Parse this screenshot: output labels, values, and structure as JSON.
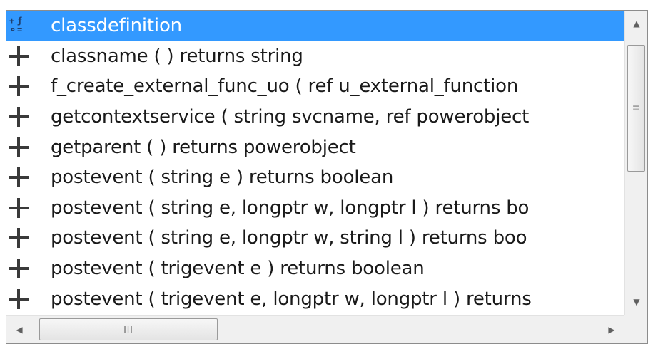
{
  "list": {
    "items": [
      {
        "label": "classdefinition",
        "icon": "class-definition-icon",
        "selected": true
      },
      {
        "label": "classname ( ) returns string",
        "icon": "gear-icon"
      },
      {
        "label": "f_create_external_func_uo ( ref u_external_function",
        "icon": "gear-icon"
      },
      {
        "label": "getcontextservice ( string svcname, ref powerobject",
        "icon": "gear-icon"
      },
      {
        "label": "getparent ( ) returns powerobject",
        "icon": "gear-icon"
      },
      {
        "label": "postevent ( string e ) returns boolean",
        "icon": "gear-icon"
      },
      {
        "label": "postevent ( string e, longptr w, longptr l ) returns bo",
        "icon": "gear-icon"
      },
      {
        "label": "postevent ( string e, longptr w, string l ) returns boo",
        "icon": "gear-icon"
      },
      {
        "label": "postevent ( trigevent e ) returns boolean",
        "icon": "gear-icon"
      },
      {
        "label": "postevent ( trigevent e, longptr w, longptr l ) returns",
        "icon": "gear-icon"
      }
    ]
  },
  "colors": {
    "selection": "#3399ff",
    "text": "#1a1a1a",
    "scrollbar_track": "#f0f0f0"
  },
  "scrollbar": {
    "up_arrow": "▲",
    "down_arrow": "▼",
    "left_arrow": "◀",
    "right_arrow": "▶",
    "v_grip": "≡",
    "h_grip": "III"
  }
}
